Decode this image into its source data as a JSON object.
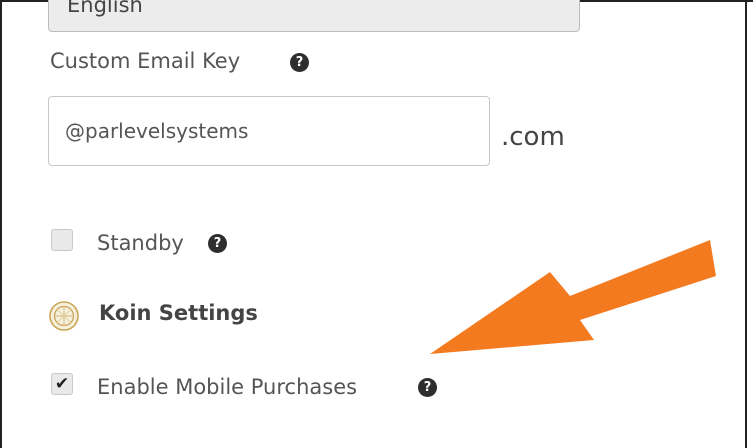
{
  "language_select": {
    "value": "English"
  },
  "custom_email": {
    "label": "Custom Email Key",
    "help_icon": "question-circle-icon",
    "value": "@parlevelsystems",
    "suffix": ".com"
  },
  "standby": {
    "label": "Standby",
    "checked": false,
    "help_icon": "question-circle-icon"
  },
  "koin_settings": {
    "title": "Koin Settings",
    "icon": "koin-coin-icon"
  },
  "enable_mobile_purchases": {
    "label": "Enable Mobile Purchases",
    "checked": true,
    "help_icon": "question-circle-icon"
  },
  "annotation": {
    "arrow_color": "#f47a20"
  },
  "colors": {
    "help_icon_bg": "#2e2e2e",
    "koin_gold": "#c9a45a",
    "frame": "#222222"
  }
}
